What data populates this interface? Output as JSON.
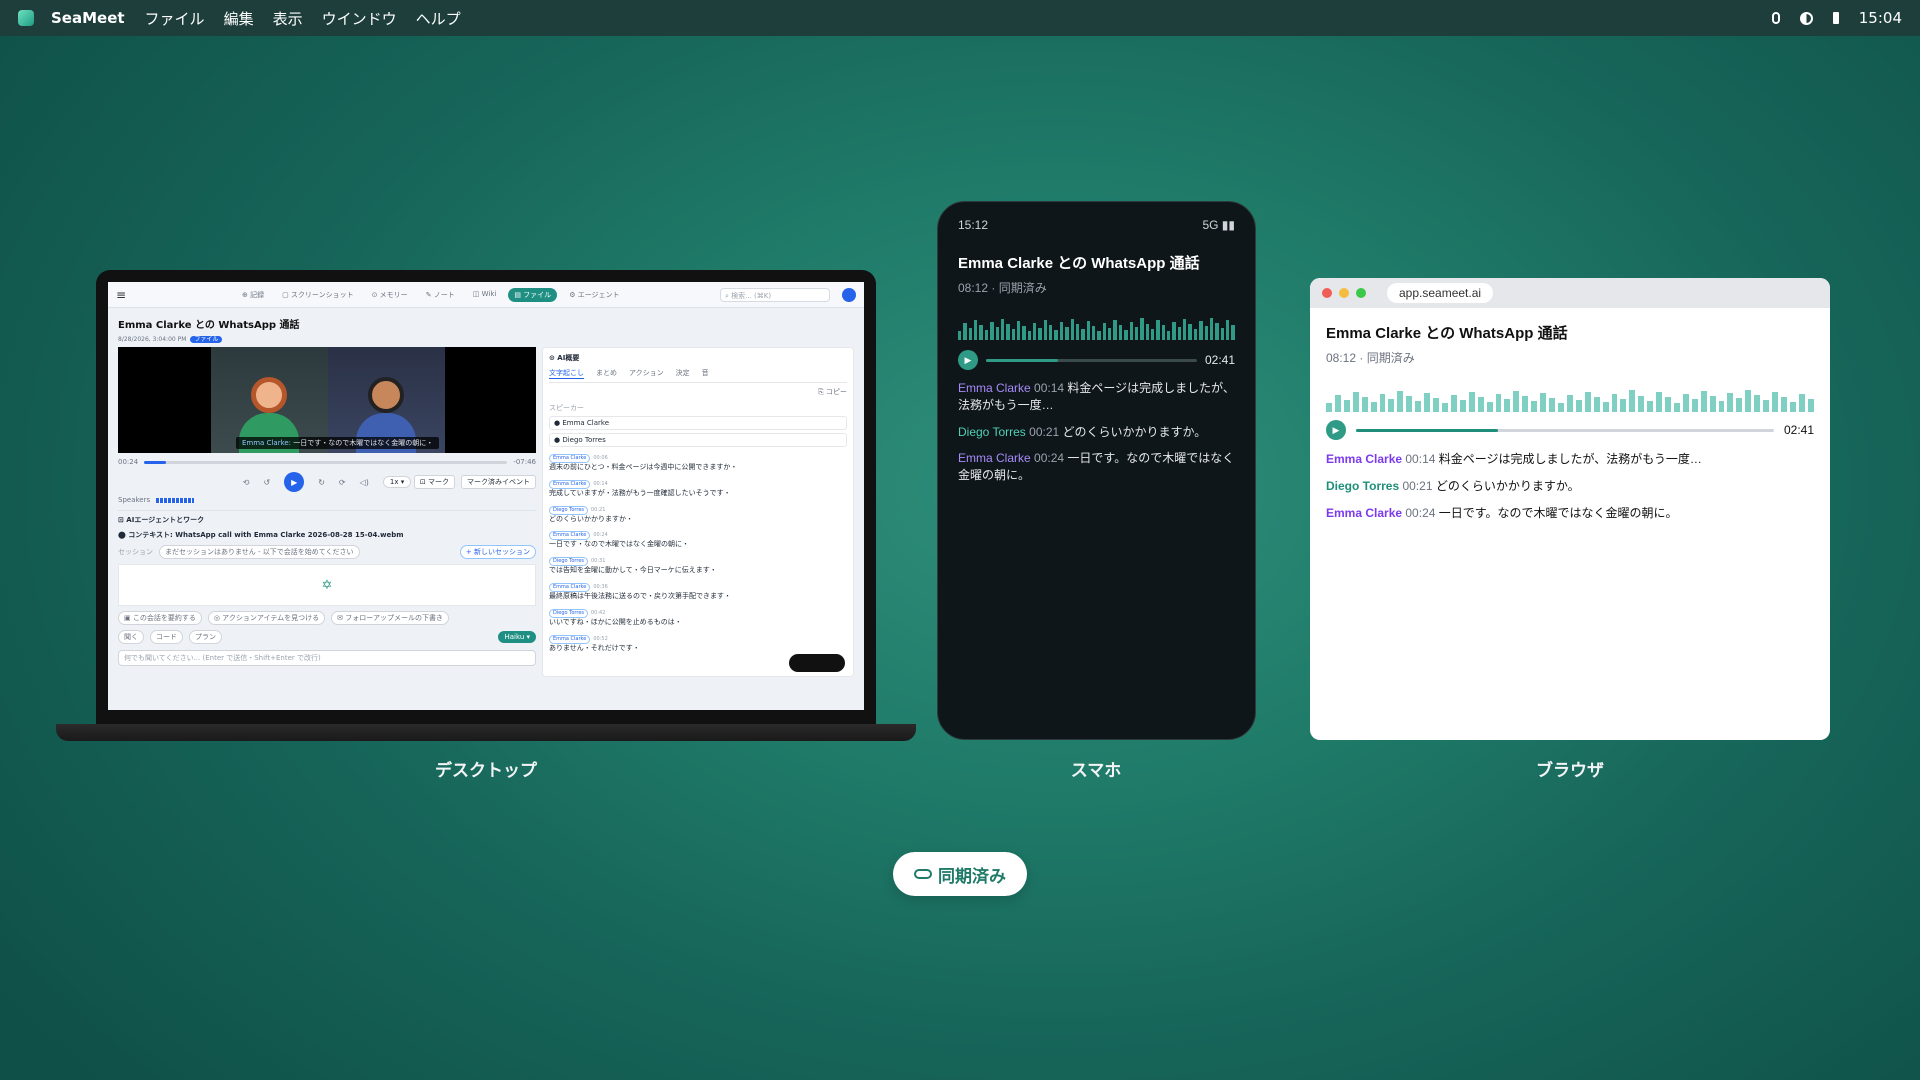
{
  "menubar": {
    "app": "SeaMeet",
    "items": [
      "ファイル",
      "編集",
      "表示",
      "ウインドウ",
      "ヘルプ"
    ],
    "clock": "15:04"
  },
  "desktop": {
    "tabs": [
      "⊕ 記録",
      "▢ スクリーンショット",
      "⊙ メモリー",
      "✎ ノート",
      "◫ Wiki",
      "▤ ファイル",
      "⚙ エージェント"
    ],
    "search_placeholder": "⌕ 検索... (⌘K)",
    "title": "Emma Clarke との WhatsApp 通話",
    "date": "8/28/2026, 3:04:00 PM",
    "badge": "ファイル",
    "caption_name": "Emma Clarke:",
    "caption_text": " 一日です・なので木曜ではなく金曜の朝に・",
    "time_current": "00:24",
    "time_remaining": "-07:46",
    "progress": 0.06,
    "rate": "1x ▾",
    "mark": "⊡ マーク",
    "marked_events": "マーク済みイベント",
    "speakers_label": "Speakers",
    "agent_title": "⊡ AIエージェントとワーク",
    "context": "⬤ コンテキスト: WhatsApp call with Emma Clarke 2026-08-28 15-04.webm",
    "session_label": "セッション",
    "session_value": "まだセッションはありません - 以下で会話を始めてください",
    "new_session": "+ 新しいセッション",
    "suggestions": [
      "▣ この会話を要約する",
      "◎ アクションアイテムを見つける",
      "✉ フォローアップメールの下書き"
    ],
    "modes": [
      "聞く",
      "コード",
      "プラン"
    ],
    "model": "Haiku ▾",
    "chat_placeholder": "何でも聞いてください... (Enter で送信・Shift+Enter で改行)",
    "ai_title": "⊙ AI概要",
    "ai_tabs": [
      "文字起こし",
      "まとめ",
      "アクション",
      "決定",
      "音"
    ],
    "copy": "⎘ コピー",
    "speaker_label": "スピーカー",
    "speakers": [
      "Emma Clarke",
      "Diego Torres"
    ],
    "transcript": [
      {
        "who": "Emma Clarke",
        "ts": "00:06",
        "text": "週末の前にひとつ・料金ページは今週中に公開できますか・"
      },
      {
        "who": "Emma Clarke",
        "ts": "00:14",
        "text": "完成していますが・法務がもう一度確認したいそうです・"
      },
      {
        "who": "Diego Torres",
        "ts": "00:21",
        "text": "どのくらいかかりますか・"
      },
      {
        "who": "Emma Clarke",
        "ts": "00:24",
        "text": "一日です・なので木曜ではなく金曜の朝に・"
      },
      {
        "who": "Diego Torres",
        "ts": "00:31",
        "text": "では告知を金曜に動かして・今日マーケに伝えます・"
      },
      {
        "who": "Emma Clarke",
        "ts": "00:36",
        "text": "最終原稿は午後法務に送るので・戻り次第手配できます・"
      },
      {
        "who": "Diego Torres",
        "ts": "00:42",
        "text": "いいですね・ほかに公開を止めるものは・"
      },
      {
        "who": "Emma Clarke",
        "ts": "00:52",
        "text": "ありません・それだけです・"
      }
    ]
  },
  "phone": {
    "time": "15:12",
    "signal": "5G ▮▮",
    "title": "Emma Clarke との WhatsApp 通話",
    "sub": "08:12 · 同期済み",
    "duration": "02:41",
    "progress": 0.34,
    "lines": [
      {
        "who": "Emma Clarke",
        "ts": "00:14",
        "text": "料金ページは完成しましたが、法務がもう一度…"
      },
      {
        "who": "Diego Torres",
        "ts": "00:21",
        "text": "どのくらいかかりますか。"
      },
      {
        "who": "Emma Clarke",
        "ts": "00:24",
        "text": "一日です。なので木曜ではなく金曜の朝に。"
      }
    ]
  },
  "browser": {
    "url": "app.seameet.ai",
    "title": "Emma Clarke との WhatsApp 通話",
    "sub": "08:12 · 同期済み",
    "duration": "02:41",
    "progress": 0.34,
    "lines": [
      {
        "who": "Emma Clarke",
        "ts": "00:14",
        "text": "料金ページは完成しましたが、法務がもう一度…"
      },
      {
        "who": "Diego Torres",
        "ts": "00:21",
        "text": "どのくらいかかりますか。"
      },
      {
        "who": "Emma Clarke",
        "ts": "00:24",
        "text": "一日です。なので木曜ではなく金曜の朝に。"
      }
    ]
  },
  "labels": {
    "desktop": "デスクトップ",
    "phone": "スマホ",
    "browser": "ブラウザ"
  },
  "sync_label": "同期済み",
  "colors": {
    "accent": "#2f9a85",
    "bg": "#1f7a68",
    "blue": "#2563eb"
  }
}
